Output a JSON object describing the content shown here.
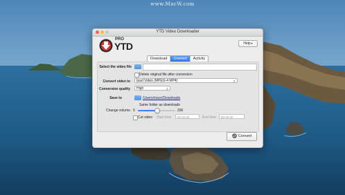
{
  "watermark": "www.MacW.com",
  "window": {
    "title": "YTD Video Downloader"
  },
  "logo": {
    "pro": "PRO",
    "ytd": "YTD"
  },
  "help": {
    "label": "Help"
  },
  "tabs": [
    {
      "label": "Download",
      "active": false
    },
    {
      "label": "Convert",
      "active": true
    },
    {
      "label": "Activity",
      "active": false
    }
  ],
  "form": {
    "select_video_label": "Select the video file",
    "delete_original_label": "Delete original file after conversion",
    "delete_original_checked": false,
    "convert_to_label": "Convert video to",
    "convert_to_value": "Ipad Video (MPEG-4 MP4)",
    "quality_label": "Conversion quality",
    "quality_value": "High",
    "save_to_label": "Save to",
    "save_to_path": "/Users/mace/Downloads",
    "same_folder_label": "Same folder as downloads",
    "volume_label": "Change volume",
    "volume_min": "0",
    "volume_max": "200",
    "volume_value_fraction": 0.5,
    "cut_video_label": "Cut video",
    "cut_video_checked": false,
    "start_time_label": "Start time",
    "start_time_value": "00:00:00",
    "end_time_label": "End time",
    "end_time_value": "00:00:00"
  },
  "convert_button": {
    "label": "Convert"
  },
  "colors": {
    "accent": "#2e78e6",
    "logo_red": "#d8312a"
  }
}
